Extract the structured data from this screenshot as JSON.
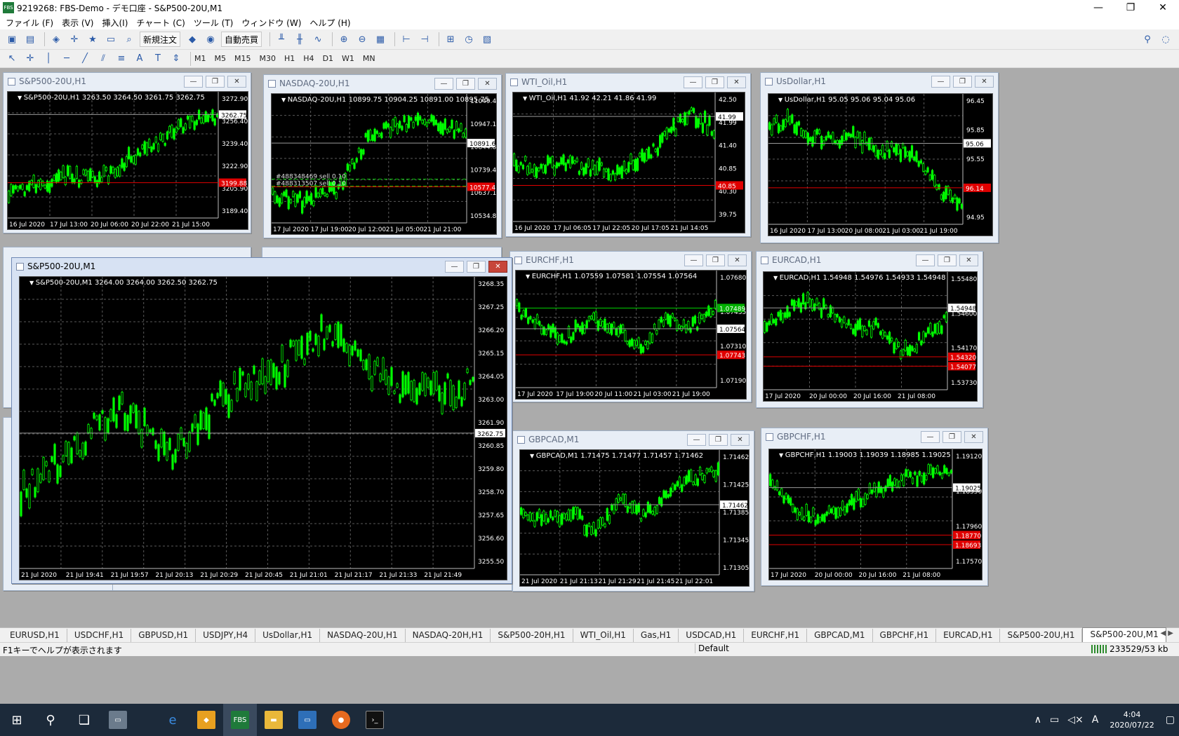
{
  "window": {
    "title": "9219268: FBS-Demo - デモ口座 - S&P500-20U,M1",
    "min": "—",
    "max": "❐",
    "close": "✕"
  },
  "menu": [
    "ファイル (F)",
    "表示 (V)",
    "挿入(I)",
    "チャート (C)",
    "ツール (T)",
    "ウィンドウ (W)",
    "ヘルプ (H)"
  ],
  "toolbar": {
    "new_order": "新規注文",
    "autotrade": "自動売買"
  },
  "timeframes": [
    "M1",
    "M5",
    "M15",
    "M30",
    "H1",
    "H4",
    "D1",
    "W1",
    "MN"
  ],
  "colors": {
    "candle": "#00ff00",
    "grid": "#5a5a5a",
    "red_line": "#e00000",
    "bg": "#000000"
  },
  "charts": [
    {
      "title": "S&P500-20U,H1",
      "info": "S&P500-20U,H1  3263.50 3264.50 3261.75 3262.75",
      "prices": [
        "3272.90",
        "3256.40",
        "3239.40",
        "3222.90",
        "3205.90",
        "3189.40"
      ],
      "current": "3262.75",
      "red_label": "3199.88",
      "dates": [
        "16 Jul 2020",
        "17 Jul 13:00",
        "20 Jul 06:00",
        "20 Jul 22:00",
        "21 Jul 15:00"
      ]
    },
    {
      "title": "NASDAQ-20U,H1",
      "info": "NASDAQ-20U,H1  10899.75 10904.25 10891.00 10895.75",
      "prices": [
        "11049.40",
        "10947.10",
        "10844.80",
        "10739.40",
        "10637.10",
        "10534.80"
      ],
      "current": "10891.61",
      "red_label": "10577.41",
      "dates": [
        "17 Jul 2020",
        "17 Jul 19:00",
        "20 Jul 12:00",
        "21 Jul 05:00",
        "21 Jul 21:00"
      ],
      "orders": [
        "#488348469 sell 0.10",
        "#488313507 sell 0.10"
      ]
    },
    {
      "title": "WTI_Oil,H1",
      "info": "WTI_Oil,H1  41.92 42.21 41.86 41.99",
      "prices": [
        "42.50",
        "41.99",
        "41.40",
        "40.85",
        "40.30",
        "39.75"
      ],
      "current": "41.99",
      "red_label": "40.85",
      "dates": [
        "16 Jul 2020",
        "17 Jul 06:05",
        "17 Jul 22:05",
        "20 Jul 17:05",
        "21 Jul 14:05"
      ]
    },
    {
      "title": "UsDollar,H1",
      "info": "UsDollar,H1  95.05 95.06 95.04 95.06",
      "prices": [
        "96.45",
        "95.85",
        "95.55",
        "95.25",
        "94.95"
      ],
      "current": "95.06",
      "red_label": "96.14",
      "dates": [
        "16 Jul 2020",
        "17 Jul 13:00",
        "20 Jul 08:00",
        "21 Jul 03:00",
        "21 Jul 19:00"
      ]
    },
    {
      "title": "S&P500-20U,M1",
      "info": "S&P500-20U,M1  3264.00 3264.00 3262.50 3262.75",
      "prices": [
        "3268.35",
        "3267.25",
        "3266.20",
        "3265.15",
        "3264.05",
        "3263.00",
        "3261.90",
        "3260.85",
        "3259.80",
        "3258.70",
        "3257.65",
        "3256.60",
        "3255.50"
      ],
      "current": "3262.75",
      "dates": [
        "21 Jul 2020",
        "21 Jul 19:41",
        "21 Jul 19:57",
        "21 Jul 20:13",
        "21 Jul 20:29",
        "21 Jul 20:45",
        "21 Jul 21:01",
        "21 Jul 21:17",
        "21 Jul 21:33",
        "21 Jul 21:49"
      ]
    },
    {
      "title": "EURCHF,H1",
      "info": "EURCHF,H1  1.07559 1.07581 1.07554 1.07564",
      "prices": [
        "1.07680",
        "1.07435",
        "1.07310",
        "1.07190"
      ],
      "current": "1.07564",
      "red_label": "1.07743",
      "green_label": "1.07489",
      "dates": [
        "17 Jul 2020",
        "17 Jul 19:00",
        "20 Jul 11:00",
        "21 Jul 03:00",
        "21 Jul 19:00"
      ]
    },
    {
      "title": "EURCAD,H1",
      "info": "EURCAD,H1  1.54948 1.54976 1.54933 1.54948",
      "prices": [
        "1.55480",
        "1.54600",
        "1.54170",
        "1.53730"
      ],
      "current": "1.54948",
      "red_label": "1.54320",
      "red_label2": "1.54077",
      "dates": [
        "17 Jul 2020",
        "20 Jul 00:00",
        "20 Jul 16:00",
        "21 Jul 08:00"
      ]
    },
    {
      "title": "GBPCAD,M1",
      "info": "GBPCAD,M1  1.71475 1.71477 1.71457 1.71462",
      "prices": [
        "1.71462",
        "1.71425",
        "1.71385",
        "1.71345",
        "1.71305"
      ],
      "current": "1.71462",
      "dates": [
        "21 Jul 2020",
        "21 Jul 21:13",
        "21 Jul 21:29",
        "21 Jul 21:45",
        "21 Jul 22:01"
      ]
    },
    {
      "title": "GBPCHF,H1",
      "info": "GBPCHF,H1  1.19003 1.19039 1.18985 1.19025",
      "prices": [
        "1.19120",
        "1.18350",
        "1.17960",
        "1.17570"
      ],
      "current": "1.19025",
      "red_label": "1.18770",
      "red_label2": "1.18693",
      "dates": [
        "17 Jul 2020",
        "20 Jul 00:00",
        "20 Jul 16:00",
        "21 Jul 08:00"
      ]
    }
  ],
  "tabs": [
    "EURUSD,H1",
    "USDCHF,H1",
    "GBPUSD,H1",
    "USDJPY,H4",
    "UsDollar,H1",
    "NASDAQ-20U,H1",
    "NASDAQ-20H,H1",
    "S&P500-20H,H1",
    "WTI_Oil,H1",
    "Gas,H1",
    "USDCAD,H1",
    "EURCHF,H1",
    "GBPCAD,M1",
    "GBPCHF,H1",
    "EURCAD,H1",
    "S&P500-20U,H1",
    "S&P500-20U,M1"
  ],
  "active_tab": "S&P500-20U,M1",
  "status": {
    "help": "F1キーでヘルプが表示されます",
    "profile": "Default",
    "traffic": "233529/53 kb"
  },
  "taskbar": {
    "time": "4:04",
    "date": "2020/07/22",
    "ime": "A"
  }
}
